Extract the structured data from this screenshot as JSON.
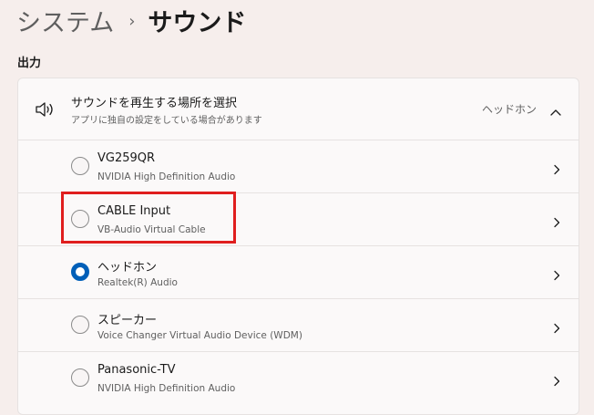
{
  "breadcrumb": {
    "parent": "システム",
    "separator": "›",
    "current": "サウンド"
  },
  "output": {
    "section_title": "出力",
    "header": {
      "title": "サウンドを再生する場所を選択",
      "subtitle": "アプリに独自の設定をしている場合があります",
      "selected_value": "ヘッドホン",
      "icon": "speaker-icon",
      "expand_icon": "chevron-up-icon"
    },
    "devices": [
      {
        "name": "VG259QR",
        "description": "NVIDIA High Definition Audio",
        "selected": false
      },
      {
        "name": "CABLE Input",
        "description": "VB-Audio Virtual Cable",
        "selected": false
      },
      {
        "name": "ヘッドホン",
        "description": "Realtek(R) Audio",
        "selected": true
      },
      {
        "name": "スピーカー",
        "description": "Voice Changer Virtual Audio Device (WDM)",
        "selected": false
      },
      {
        "name": "Panasonic-TV",
        "description": "NVIDIA High Definition Audio",
        "selected": false
      }
    ]
  },
  "colors": {
    "accent": "#005fb8",
    "highlight": "#e01e1e",
    "background": "#f6eeec"
  }
}
